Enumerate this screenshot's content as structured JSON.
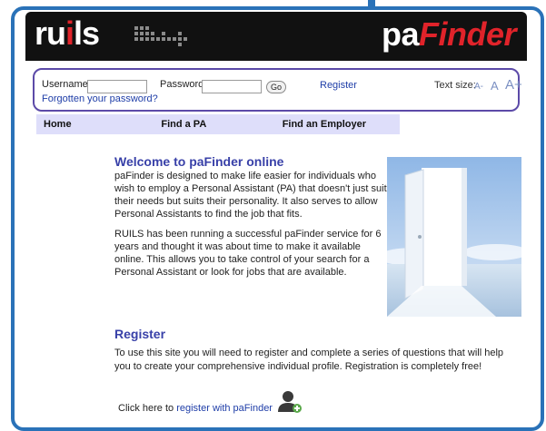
{
  "header": {
    "logo_left_main": "ru",
    "logo_left_i": "i",
    "logo_left_end": "ls",
    "logo_right_pa": "pa",
    "logo_right_finder": "Finder"
  },
  "login": {
    "username_label": "Username",
    "password_label": "Password",
    "go_label": "Go",
    "register_link": "Register",
    "forgot_link": "Forgotten your password?",
    "text_size_label": "Text size:",
    "ts_small": "A-",
    "ts_normal": "A",
    "ts_large": "A+"
  },
  "nav": {
    "items": [
      "Home",
      "Find a PA",
      "Find an Employer"
    ]
  },
  "welcome": {
    "title": "Welcome to paFinder online",
    "para1": "paFinder is designed to make life easier for individuals who wish to employ a Personal Assistant (PA) that doesn't just suit their needs but suits their personality. It also serves to allow Personal Assistants to find the job that fits.",
    "para2": "RUILS has been running a successful paFinder service for 6 years and thought it was about time to make it available online. This allows you to take control of your search for a Personal Assistant or look for jobs that are available."
  },
  "register_section": {
    "title": "Register",
    "text": "To use this site you will need to register and complete a series of questions that will help you to create your comprehensive individual profile. Registration is completely free!",
    "click_prefix": "Click here to",
    "click_link": "register with paFinder"
  },
  "colors": {
    "frame": "#2a72b8",
    "header_bg": "#111111",
    "accent_red": "#e0232a",
    "login_border": "#5c4aa8",
    "nav_bg": "#dedefa",
    "heading": "#3840a8"
  }
}
